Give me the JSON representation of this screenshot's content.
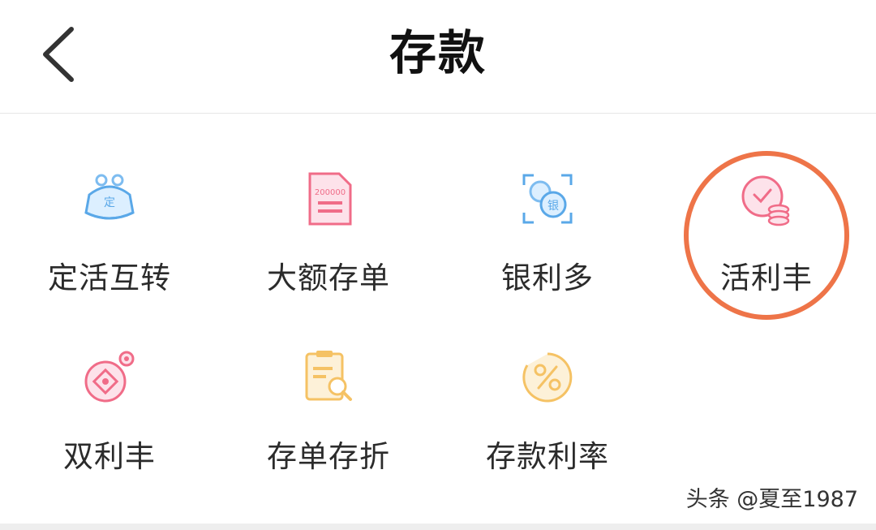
{
  "header": {
    "title": "存款"
  },
  "items": [
    {
      "label": "定活互转",
      "icon": "piggy-purse-icon",
      "color": "#5aa8e8"
    },
    {
      "label": "大额存单",
      "icon": "certificate-document-icon",
      "color": "#f06c88"
    },
    {
      "label": "银利多",
      "icon": "bank-coin-scan-icon",
      "color": "#5aa8e8"
    },
    {
      "label": "活利丰",
      "icon": "clock-coins-icon",
      "color": "#f06c88"
    },
    {
      "label": "双利丰",
      "icon": "double-coin-icon",
      "color": "#f06c88"
    },
    {
      "label": "存单存折",
      "icon": "passbook-search-icon",
      "color": "#f5c264"
    },
    {
      "label": "存款利率",
      "icon": "percent-circle-icon",
      "color": "#f5c264"
    }
  ],
  "highlight": {
    "color": "#ee7448",
    "target": "活利丰"
  },
  "watermark": "头条 @夏至1987"
}
